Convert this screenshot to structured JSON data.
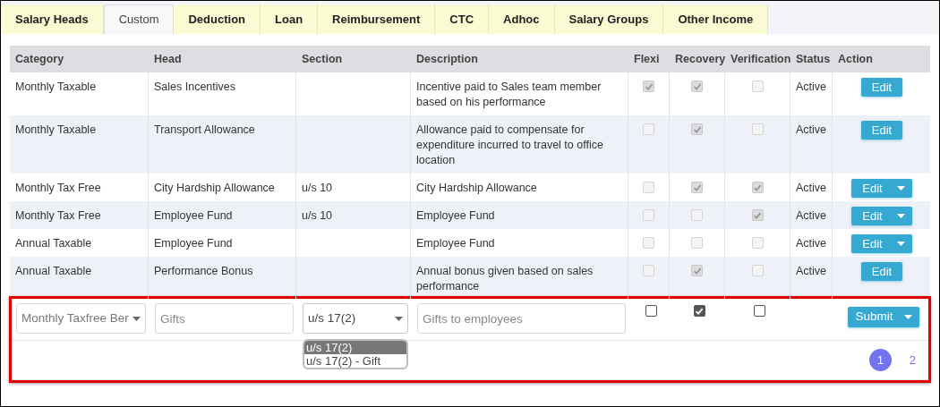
{
  "tabs": [
    {
      "label": "Salary Heads",
      "selected": false
    },
    {
      "label": "Custom",
      "selected": true
    },
    {
      "label": "Deduction",
      "selected": false
    },
    {
      "label": "Loan",
      "selected": false
    },
    {
      "label": "Reimbursement",
      "selected": false
    },
    {
      "label": "CTC",
      "selected": false
    },
    {
      "label": "Adhoc",
      "selected": false
    },
    {
      "label": "Salary Groups",
      "selected": false
    },
    {
      "label": "Other Income",
      "selected": false
    }
  ],
  "table": {
    "columns": [
      "Category",
      "Head",
      "Section",
      "Description",
      "Flexi",
      "Recovery",
      "Verification",
      "Status",
      "Action"
    ],
    "rows": [
      {
        "category": "Monthly Taxable",
        "head": "Sales Incentives",
        "section": "",
        "description": "Incentive paid to Sales team member based on his performance",
        "flexi": true,
        "recovery": true,
        "verification": false,
        "disabled": true,
        "status": "Active",
        "action": {
          "label": "Edit",
          "kind": "plain"
        }
      },
      {
        "category": "Monthly Taxable",
        "head": "Transport Allowance",
        "section": "",
        "description": "Allowance paid to compensate for expenditure incurred to travel to office location",
        "flexi": false,
        "recovery": true,
        "verification": false,
        "disabled": true,
        "status": "Active",
        "action": {
          "label": "Edit",
          "kind": "plain"
        }
      },
      {
        "category": "Monthly Tax Free",
        "head": "City Hardship Allowance",
        "section": "u/s 10",
        "description": "City Hardship Allowance",
        "flexi": false,
        "recovery": true,
        "verification": true,
        "disabled": true,
        "status": "Active",
        "action": {
          "label": "Edit",
          "kind": "split"
        }
      },
      {
        "category": "Monthly Tax Free",
        "head": "Employee Fund",
        "section": "u/s 10",
        "description": "Employee Fund",
        "flexi": false,
        "recovery": false,
        "verification": true,
        "disabled": true,
        "status": "Active",
        "action": {
          "label": "Edit",
          "kind": "split"
        }
      },
      {
        "category": "Annual Taxable",
        "head": "Employee Fund",
        "section": "",
        "description": "Employee Fund",
        "flexi": false,
        "recovery": false,
        "verification": false,
        "disabled": true,
        "status": "Active",
        "action": {
          "label": "Edit",
          "kind": "split"
        }
      },
      {
        "category": "Annual Taxable",
        "head": "Performance Bonus",
        "section": "",
        "description": "Annual bonus given based on sales performance",
        "flexi": false,
        "recovery": true,
        "verification": false,
        "disabled": true,
        "status": "Active",
        "action": {
          "label": "Edit",
          "kind": "plain"
        }
      }
    ]
  },
  "new_row": {
    "highlighted": true,
    "category": {
      "value": "Monthly Taxfree Ber"
    },
    "head": {
      "placeholder": "Gifts"
    },
    "section": {
      "value": "u/s 17(2)",
      "expanded": true,
      "options": [
        {
          "label": "u/s 17(2)",
          "selected": true
        },
        {
          "label": "u/s 17(2) - Gift",
          "selected": false
        }
      ]
    },
    "description": {
      "placeholder": "Gifts to employees"
    },
    "flexi": false,
    "recovery": true,
    "verification": false,
    "disabled": false,
    "submit": {
      "label": "Submit",
      "kind": "split"
    }
  },
  "pagination": [
    {
      "label": "1",
      "selected": true
    },
    {
      "label": "2",
      "selected": false
    }
  ]
}
